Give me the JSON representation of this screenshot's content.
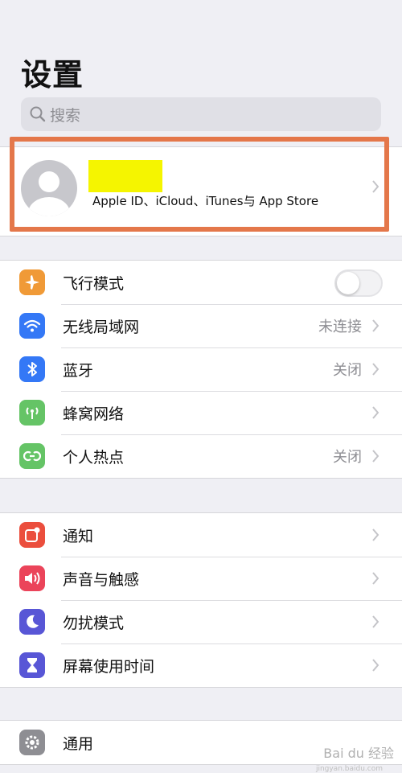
{
  "header": {
    "title": "设置"
  },
  "search": {
    "placeholder": "搜索"
  },
  "profile": {
    "subtitle": "Apple ID、iCloud、iTunes与 App Store"
  },
  "groups": [
    {
      "items": [
        {
          "label": "飞行模式",
          "icon": "airplane-icon",
          "color": "#f09a37",
          "toggle": false
        },
        {
          "label": "无线局域网",
          "icon": "wifi-icon",
          "color": "#3478f6",
          "value": "未连接"
        },
        {
          "label": "蓝牙",
          "icon": "bluetooth-icon",
          "color": "#3478f6",
          "value": "关闭"
        },
        {
          "label": "蜂窝网络",
          "icon": "cellular-icon",
          "color": "#65c466"
        },
        {
          "label": "个人热点",
          "icon": "hotspot-icon",
          "color": "#65c466",
          "value": "关闭"
        }
      ]
    },
    {
      "items": [
        {
          "label": "通知",
          "icon": "notifications-icon",
          "color": "#eb4e3d"
        },
        {
          "label": "声音与触感",
          "icon": "sounds-icon",
          "color": "#eb445a"
        },
        {
          "label": "勿扰模式",
          "icon": "moon-icon",
          "color": "#5856d6"
        },
        {
          "label": "屏幕使用时间",
          "icon": "hourglass-icon",
          "color": "#5856d6"
        }
      ]
    },
    {
      "items": [
        {
          "label": "通用",
          "icon": "gear-icon",
          "color": "#8e8e93"
        }
      ]
    }
  ],
  "watermark": {
    "text": "Bai du 经验",
    "sub": "jingyan.baidu.com"
  }
}
